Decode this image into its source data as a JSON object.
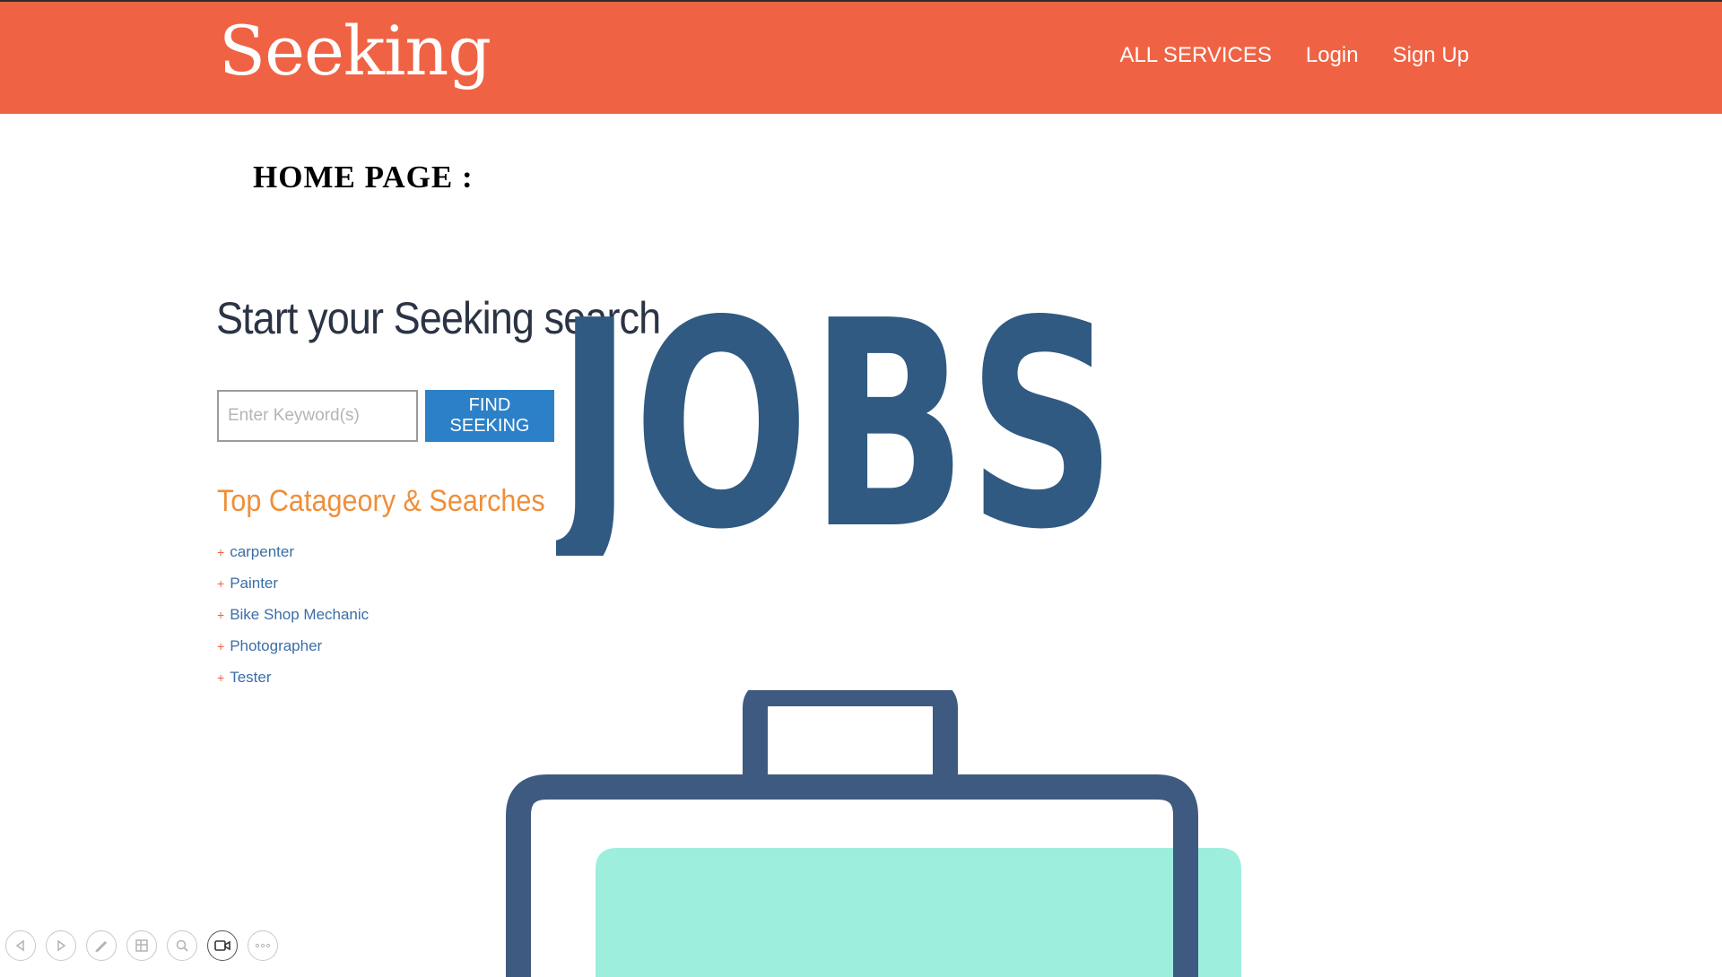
{
  "navbar": {
    "logo": "Seeking",
    "links": [
      "ALL SERVICES",
      "Login",
      "Sign Up"
    ]
  },
  "page_heading": "HOME PAGE :",
  "hero": {
    "title": "Start your Seeking search",
    "graphic_text": "JOBS"
  },
  "search": {
    "placeholder": "Enter Keyword(s)",
    "value": "",
    "button_label": "FIND SEEKING"
  },
  "categories": {
    "heading": "Top Catageory & Searches",
    "items": [
      "carpenter",
      "Painter",
      "Bike Shop Mechanic",
      "Photographer",
      "Tester"
    ]
  },
  "colors": {
    "navbar": "#ef6344",
    "button": "#2c80c7",
    "jobs_text": "#305a82",
    "briefcase_outline": "#3e5a80",
    "briefcase_fill": "#9eeedd",
    "category_heading": "#ef8f3a"
  },
  "toolbar": {
    "icons": [
      "previous-icon",
      "next-icon",
      "pen-icon",
      "grid-icon",
      "zoom-icon",
      "video-camera-icon",
      "more-icon"
    ]
  }
}
